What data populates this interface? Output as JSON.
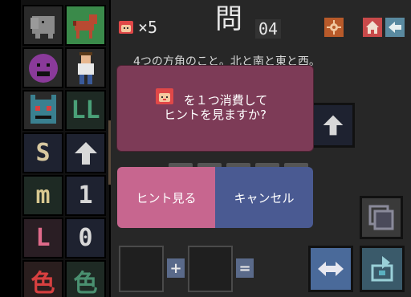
{
  "header": {
    "hint_count": "×5",
    "question_char": "問",
    "question_number": "04"
  },
  "clue": "4つの方角のこと。北と南と東と西。",
  "tiles": [
    {
      "icon": "elephant-icon",
      "color": "#8a8a8a"
    },
    {
      "icon": "horse-icon",
      "color": "#c04a3a"
    },
    {
      "icon": "smiley-icon",
      "color": "#8a3a9a"
    },
    {
      "icon": "person-icon",
      "color": "#5a86b0"
    },
    {
      "icon": "monster-icon",
      "color": "#3a8090"
    },
    {
      "label": "LL",
      "color": "#4aa078"
    },
    {
      "label": "S",
      "color": "#d8c8a0"
    },
    {
      "icon": "arrow-up-icon",
      "color": "#d8d8d8"
    },
    {
      "label": "m",
      "color": "#d8c890"
    },
    {
      "label": "1",
      "color": "#d8d8d8"
    },
    {
      "label": "L",
      "color": "#e06a8a"
    },
    {
      "label": "0",
      "color": "#d8d8d8"
    },
    {
      "label": "色",
      "color": "#d84040"
    },
    {
      "label": "色",
      "color": "#4a9070"
    }
  ],
  "dialog": {
    "line1": "を１つ消費して",
    "line2": "ヒントを見ますか?",
    "confirm_label": "ヒント見る",
    "cancel_label": "キャンセル"
  },
  "answer": {
    "plus": "+",
    "equals": "="
  },
  "colors": {
    "dialog_bg": "#7d3b57",
    "confirm_bg": "#c7668f",
    "cancel_bg": "#4a5a92",
    "game_bg": "#272727"
  }
}
